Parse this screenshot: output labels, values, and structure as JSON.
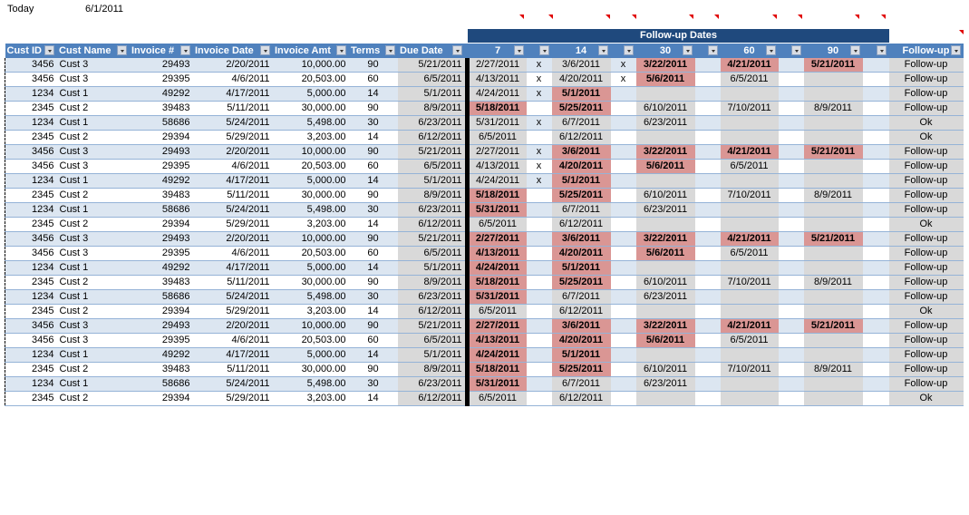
{
  "today": {
    "label": "Today",
    "value": "6/1/2011"
  },
  "banner": "Follow-up Dates",
  "headers": [
    "Cust ID",
    "Cust Name",
    "Invoice #",
    "Invoice Date",
    "Invoice Amt",
    "Terms",
    "Due Date",
    "7",
    "",
    "14",
    "",
    "30",
    "",
    "60",
    "",
    "90",
    "",
    "Follow-up"
  ],
  "colors": {
    "header": "#4f81bd",
    "banner": "#1f497d",
    "highlight": "#da9694",
    "band": "#dce6f1",
    "grey": "#d9d9d9"
  },
  "rows": [
    {
      "id": "3456",
      "name": "Cust 3",
      "inv": "29493",
      "date": "2/20/2011",
      "amt": "10,000.00",
      "terms": "90",
      "due": "5/21/2011",
      "f": [
        [
          "2/27/2011",
          0
        ],
        [
          "x"
        ],
        [
          "3/6/2011",
          0
        ],
        [
          "x"
        ],
        [
          "3/22/2011",
          1
        ],
        [
          ""
        ],
        [
          "4/21/2011",
          1
        ],
        [
          ""
        ],
        [
          "5/21/2011",
          1
        ],
        [
          ""
        ]
      ],
      "status": "Follow-up"
    },
    {
      "id": "3456",
      "name": "Cust 3",
      "inv": "29395",
      "date": "4/6/2011",
      "amt": "20,503.00",
      "terms": "60",
      "due": "6/5/2011",
      "f": [
        [
          "4/13/2011",
          0
        ],
        [
          "x"
        ],
        [
          "4/20/2011",
          0
        ],
        [
          "x"
        ],
        [
          "5/6/2011",
          1
        ],
        [
          ""
        ],
        [
          "6/5/2011",
          0
        ],
        [
          ""
        ],
        [
          "",
          0
        ],
        [
          ""
        ]
      ],
      "status": "Follow-up"
    },
    {
      "id": "1234",
      "name": "Cust 1",
      "inv": "49292",
      "date": "4/17/2011",
      "amt": "5,000.00",
      "terms": "14",
      "due": "5/1/2011",
      "f": [
        [
          "4/24/2011",
          0
        ],
        [
          "x"
        ],
        [
          "5/1/2011",
          1
        ],
        [
          ""
        ],
        [
          "",
          0
        ],
        [
          ""
        ],
        [
          "",
          0
        ],
        [
          ""
        ],
        [
          "",
          0
        ],
        [
          ""
        ]
      ],
      "status": "Follow-up"
    },
    {
      "id": "2345",
      "name": "Cust 2",
      "inv": "39483",
      "date": "5/11/2011",
      "amt": "30,000.00",
      "terms": "90",
      "due": "8/9/2011",
      "f": [
        [
          "5/18/2011",
          1
        ],
        [
          ""
        ],
        [
          "5/25/2011",
          1
        ],
        [
          ""
        ],
        [
          "6/10/2011",
          0
        ],
        [
          ""
        ],
        [
          "7/10/2011",
          0
        ],
        [
          ""
        ],
        [
          "8/9/2011",
          0
        ],
        [
          ""
        ]
      ],
      "status": "Follow-up"
    },
    {
      "id": "1234",
      "name": "Cust 1",
      "inv": "58686",
      "date": "5/24/2011",
      "amt": "5,498.00",
      "terms": "30",
      "due": "6/23/2011",
      "f": [
        [
          "5/31/2011",
          0
        ],
        [
          "x"
        ],
        [
          "6/7/2011",
          0
        ],
        [
          ""
        ],
        [
          "6/23/2011",
          0
        ],
        [
          ""
        ],
        [
          "",
          0
        ],
        [
          ""
        ],
        [
          "",
          0
        ],
        [
          ""
        ]
      ],
      "status": "Ok"
    },
    {
      "id": "2345",
      "name": "Cust 2",
      "inv": "29394",
      "date": "5/29/2011",
      "amt": "3,203.00",
      "terms": "14",
      "due": "6/12/2011",
      "f": [
        [
          "6/5/2011",
          0
        ],
        [
          ""
        ],
        [
          "6/12/2011",
          0
        ],
        [
          ""
        ],
        [
          "",
          0
        ],
        [
          ""
        ],
        [
          "",
          0
        ],
        [
          ""
        ],
        [
          "",
          0
        ],
        [
          ""
        ]
      ],
      "status": "Ok"
    },
    {
      "id": "3456",
      "name": "Cust 3",
      "inv": "29493",
      "date": "2/20/2011",
      "amt": "10,000.00",
      "terms": "90",
      "due": "5/21/2011",
      "f": [
        [
          "2/27/2011",
          0
        ],
        [
          "x"
        ],
        [
          "3/6/2011",
          1
        ],
        [
          ""
        ],
        [
          "3/22/2011",
          1
        ],
        [
          ""
        ],
        [
          "4/21/2011",
          1
        ],
        [
          ""
        ],
        [
          "5/21/2011",
          1
        ],
        [
          ""
        ]
      ],
      "status": "Follow-up"
    },
    {
      "id": "3456",
      "name": "Cust 3",
      "inv": "29395",
      "date": "4/6/2011",
      "amt": "20,503.00",
      "terms": "60",
      "due": "6/5/2011",
      "f": [
        [
          "4/13/2011",
          0
        ],
        [
          "x"
        ],
        [
          "4/20/2011",
          1
        ],
        [
          ""
        ],
        [
          "5/6/2011",
          1
        ],
        [
          ""
        ],
        [
          "6/5/2011",
          0
        ],
        [
          ""
        ],
        [
          "",
          0
        ],
        [
          ""
        ]
      ],
      "status": "Follow-up"
    },
    {
      "id": "1234",
      "name": "Cust 1",
      "inv": "49292",
      "date": "4/17/2011",
      "amt": "5,000.00",
      "terms": "14",
      "due": "5/1/2011",
      "f": [
        [
          "4/24/2011",
          0
        ],
        [
          "x"
        ],
        [
          "5/1/2011",
          1
        ],
        [
          ""
        ],
        [
          "",
          0
        ],
        [
          ""
        ],
        [
          "",
          0
        ],
        [
          ""
        ],
        [
          "",
          0
        ],
        [
          ""
        ]
      ],
      "status": "Follow-up"
    },
    {
      "id": "2345",
      "name": "Cust 2",
      "inv": "39483",
      "date": "5/11/2011",
      "amt": "30,000.00",
      "terms": "90",
      "due": "8/9/2011",
      "f": [
        [
          "5/18/2011",
          1
        ],
        [
          ""
        ],
        [
          "5/25/2011",
          1
        ],
        [
          ""
        ],
        [
          "6/10/2011",
          0
        ],
        [
          ""
        ],
        [
          "7/10/2011",
          0
        ],
        [
          ""
        ],
        [
          "8/9/2011",
          0
        ],
        [
          ""
        ]
      ],
      "status": "Follow-up"
    },
    {
      "id": "1234",
      "name": "Cust 1",
      "inv": "58686",
      "date": "5/24/2011",
      "amt": "5,498.00",
      "terms": "30",
      "due": "6/23/2011",
      "f": [
        [
          "5/31/2011",
          1
        ],
        [
          ""
        ],
        [
          "6/7/2011",
          0
        ],
        [
          ""
        ],
        [
          "6/23/2011",
          0
        ],
        [
          ""
        ],
        [
          "",
          0
        ],
        [
          ""
        ],
        [
          "",
          0
        ],
        [
          ""
        ]
      ],
      "status": "Follow-up"
    },
    {
      "id": "2345",
      "name": "Cust 2",
      "inv": "29394",
      "date": "5/29/2011",
      "amt": "3,203.00",
      "terms": "14",
      "due": "6/12/2011",
      "f": [
        [
          "6/5/2011",
          0
        ],
        [
          ""
        ],
        [
          "6/12/2011",
          0
        ],
        [
          ""
        ],
        [
          "",
          0
        ],
        [
          ""
        ],
        [
          "",
          0
        ],
        [
          ""
        ],
        [
          "",
          0
        ],
        [
          ""
        ]
      ],
      "status": "Ok"
    },
    {
      "id": "3456",
      "name": "Cust 3",
      "inv": "29493",
      "date": "2/20/2011",
      "amt": "10,000.00",
      "terms": "90",
      "due": "5/21/2011",
      "f": [
        [
          "2/27/2011",
          1
        ],
        [
          ""
        ],
        [
          "3/6/2011",
          1
        ],
        [
          ""
        ],
        [
          "3/22/2011",
          1
        ],
        [
          ""
        ],
        [
          "4/21/2011",
          1
        ],
        [
          ""
        ],
        [
          "5/21/2011",
          1
        ],
        [
          ""
        ]
      ],
      "status": "Follow-up"
    },
    {
      "id": "3456",
      "name": "Cust 3",
      "inv": "29395",
      "date": "4/6/2011",
      "amt": "20,503.00",
      "terms": "60",
      "due": "6/5/2011",
      "f": [
        [
          "4/13/2011",
          1
        ],
        [
          ""
        ],
        [
          "4/20/2011",
          1
        ],
        [
          ""
        ],
        [
          "5/6/2011",
          1
        ],
        [
          ""
        ],
        [
          "6/5/2011",
          0
        ],
        [
          ""
        ],
        [
          "",
          0
        ],
        [
          ""
        ]
      ],
      "status": "Follow-up"
    },
    {
      "id": "1234",
      "name": "Cust 1",
      "inv": "49292",
      "date": "4/17/2011",
      "amt": "5,000.00",
      "terms": "14",
      "due": "5/1/2011",
      "f": [
        [
          "4/24/2011",
          1
        ],
        [
          ""
        ],
        [
          "5/1/2011",
          1
        ],
        [
          ""
        ],
        [
          "",
          0
        ],
        [
          ""
        ],
        [
          "",
          0
        ],
        [
          ""
        ],
        [
          "",
          0
        ],
        [
          ""
        ]
      ],
      "status": "Follow-up"
    },
    {
      "id": "2345",
      "name": "Cust 2",
      "inv": "39483",
      "date": "5/11/2011",
      "amt": "30,000.00",
      "terms": "90",
      "due": "8/9/2011",
      "f": [
        [
          "5/18/2011",
          1
        ],
        [
          ""
        ],
        [
          "5/25/2011",
          1
        ],
        [
          ""
        ],
        [
          "6/10/2011",
          0
        ],
        [
          ""
        ],
        [
          "7/10/2011",
          0
        ],
        [
          ""
        ],
        [
          "8/9/2011",
          0
        ],
        [
          ""
        ]
      ],
      "status": "Follow-up"
    },
    {
      "id": "1234",
      "name": "Cust 1",
      "inv": "58686",
      "date": "5/24/2011",
      "amt": "5,498.00",
      "terms": "30",
      "due": "6/23/2011",
      "f": [
        [
          "5/31/2011",
          1
        ],
        [
          ""
        ],
        [
          "6/7/2011",
          0
        ],
        [
          ""
        ],
        [
          "6/23/2011",
          0
        ],
        [
          ""
        ],
        [
          "",
          0
        ],
        [
          ""
        ],
        [
          "",
          0
        ],
        [
          ""
        ]
      ],
      "status": "Follow-up"
    },
    {
      "id": "2345",
      "name": "Cust 2",
      "inv": "29394",
      "date": "5/29/2011",
      "amt": "3,203.00",
      "terms": "14",
      "due": "6/12/2011",
      "f": [
        [
          "6/5/2011",
          0
        ],
        [
          ""
        ],
        [
          "6/12/2011",
          0
        ],
        [
          ""
        ],
        [
          "",
          0
        ],
        [
          ""
        ],
        [
          "",
          0
        ],
        [
          ""
        ],
        [
          "",
          0
        ],
        [
          ""
        ]
      ],
      "status": "Ok"
    },
    {
      "id": "3456",
      "name": "Cust 3",
      "inv": "29493",
      "date": "2/20/2011",
      "amt": "10,000.00",
      "terms": "90",
      "due": "5/21/2011",
      "f": [
        [
          "2/27/2011",
          1
        ],
        [
          ""
        ],
        [
          "3/6/2011",
          1
        ],
        [
          ""
        ],
        [
          "3/22/2011",
          1
        ],
        [
          ""
        ],
        [
          "4/21/2011",
          1
        ],
        [
          ""
        ],
        [
          "5/21/2011",
          1
        ],
        [
          ""
        ]
      ],
      "status": "Follow-up"
    },
    {
      "id": "3456",
      "name": "Cust 3",
      "inv": "29395",
      "date": "4/6/2011",
      "amt": "20,503.00",
      "terms": "60",
      "due": "6/5/2011",
      "f": [
        [
          "4/13/2011",
          1
        ],
        [
          ""
        ],
        [
          "4/20/2011",
          1
        ],
        [
          ""
        ],
        [
          "5/6/2011",
          1
        ],
        [
          ""
        ],
        [
          "6/5/2011",
          0
        ],
        [
          ""
        ],
        [
          "",
          0
        ],
        [
          ""
        ]
      ],
      "status": "Follow-up"
    },
    {
      "id": "1234",
      "name": "Cust 1",
      "inv": "49292",
      "date": "4/17/2011",
      "amt": "5,000.00",
      "terms": "14",
      "due": "5/1/2011",
      "f": [
        [
          "4/24/2011",
          1
        ],
        [
          ""
        ],
        [
          "5/1/2011",
          1
        ],
        [
          ""
        ],
        [
          "",
          0
        ],
        [
          ""
        ],
        [
          "",
          0
        ],
        [
          ""
        ],
        [
          "",
          0
        ],
        [
          ""
        ]
      ],
      "status": "Follow-up"
    },
    {
      "id": "2345",
      "name": "Cust 2",
      "inv": "39483",
      "date": "5/11/2011",
      "amt": "30,000.00",
      "terms": "90",
      "due": "8/9/2011",
      "f": [
        [
          "5/18/2011",
          1
        ],
        [
          ""
        ],
        [
          "5/25/2011",
          1
        ],
        [
          ""
        ],
        [
          "6/10/2011",
          0
        ],
        [
          ""
        ],
        [
          "7/10/2011",
          0
        ],
        [
          ""
        ],
        [
          "8/9/2011",
          0
        ],
        [
          ""
        ]
      ],
      "status": "Follow-up"
    },
    {
      "id": "1234",
      "name": "Cust 1",
      "inv": "58686",
      "date": "5/24/2011",
      "amt": "5,498.00",
      "terms": "30",
      "due": "6/23/2011",
      "f": [
        [
          "5/31/2011",
          1
        ],
        [
          ""
        ],
        [
          "6/7/2011",
          0
        ],
        [
          ""
        ],
        [
          "6/23/2011",
          0
        ],
        [
          ""
        ],
        [
          "",
          0
        ],
        [
          ""
        ],
        [
          "",
          0
        ],
        [
          ""
        ]
      ],
      "status": "Follow-up"
    },
    {
      "id": "2345",
      "name": "Cust 2",
      "inv": "29394",
      "date": "5/29/2011",
      "amt": "3,203.00",
      "terms": "14",
      "due": "6/12/2011",
      "f": [
        [
          "6/5/2011",
          0
        ],
        [
          ""
        ],
        [
          "6/12/2011",
          0
        ],
        [
          ""
        ],
        [
          "",
          0
        ],
        [
          ""
        ],
        [
          "",
          0
        ],
        [
          ""
        ],
        [
          "",
          0
        ],
        [
          ""
        ]
      ],
      "status": "Ok"
    }
  ]
}
